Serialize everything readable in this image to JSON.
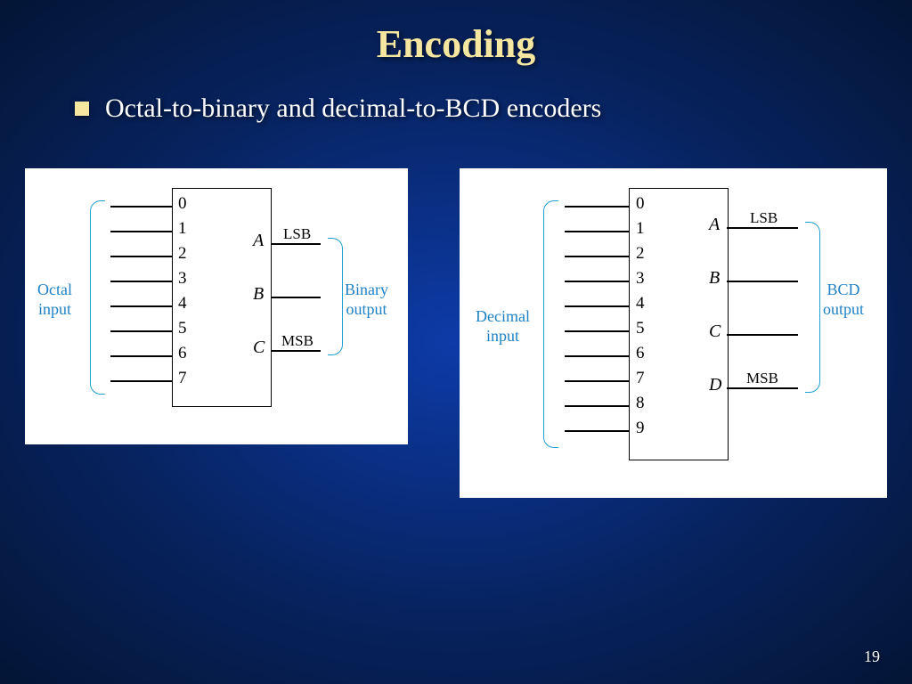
{
  "title": "Encoding",
  "bullet": "Octal-to-binary and decimal-to-BCD encoders",
  "octal": {
    "inputs": [
      "0",
      "1",
      "2",
      "3",
      "4",
      "5",
      "6",
      "7"
    ],
    "outputs": [
      "A",
      "B",
      "C"
    ],
    "lsb": "LSB",
    "msb": "MSB",
    "in_label_1": "Octal",
    "in_label_2": "input",
    "out_label_1": "Binary",
    "out_label_2": "output"
  },
  "decimal": {
    "inputs": [
      "0",
      "1",
      "2",
      "3",
      "4",
      "5",
      "6",
      "7",
      "8",
      "9"
    ],
    "outputs": [
      "A",
      "B",
      "C",
      "D"
    ],
    "lsb": "LSB",
    "msb": "MSB",
    "in_label_1": "Decimal",
    "in_label_2": "input",
    "out_label_1": "BCD",
    "out_label_2": "output"
  },
  "page": "19"
}
